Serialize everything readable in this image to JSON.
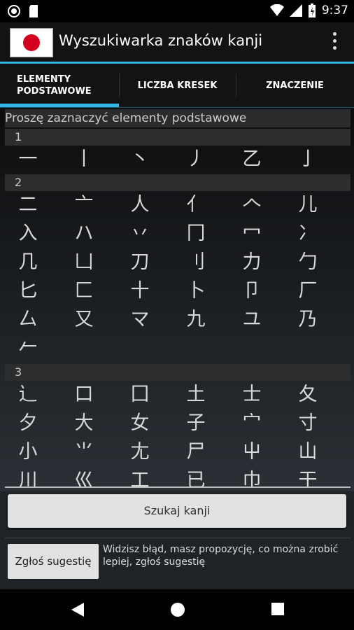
{
  "status": {
    "time": "9:37"
  },
  "app": {
    "title": "Wyszukiwarka znaków kanji",
    "menu_icon": "overflow-menu-icon"
  },
  "tabs": [
    {
      "label_line1": "ELEMENTY",
      "label_line2": "PODSTAWOWE",
      "selected": true
    },
    {
      "label": "LICZBA KRESEK",
      "selected": false
    },
    {
      "label": "ZNACZENIE",
      "selected": false
    }
  ],
  "hint": "Proszę zaznaczyć elementy podstawowe",
  "groups": [
    {
      "number": "1",
      "radicals": [
        "一",
        "丨",
        "丶",
        "丿",
        "乙",
        "亅"
      ]
    },
    {
      "number": "2",
      "radicals": [
        "二",
        "亠",
        "人",
        "亻",
        "𠆢",
        "儿",
        "入",
        "ハ",
        "丷",
        "冂",
        "冖",
        "冫",
        "几",
        "凵",
        "刀",
        "刂",
        "力",
        "勹",
        "匕",
        "匚",
        "十",
        "卜",
        "卩",
        "厂",
        "厶",
        "又",
        "マ",
        "九",
        "ユ",
        "乃",
        "𠂉"
      ]
    },
    {
      "number": "3",
      "radicals": [
        "⻌",
        "口",
        "囗",
        "土",
        "士",
        "夂",
        "夕",
        "大",
        "女",
        "子",
        "宀",
        "寸",
        "小",
        "⺌",
        "尢",
        "尸",
        "屮",
        "山",
        "川",
        "巛",
        "工",
        "已",
        "巾",
        "干"
      ]
    }
  ],
  "search_button": "Szukaj kanji",
  "suggest_button": "Zgłoś sugestię",
  "suggest_text": "Widzisz błąd, masz propozycję, co można zrobić lepiej, zgłoś sugestię"
}
